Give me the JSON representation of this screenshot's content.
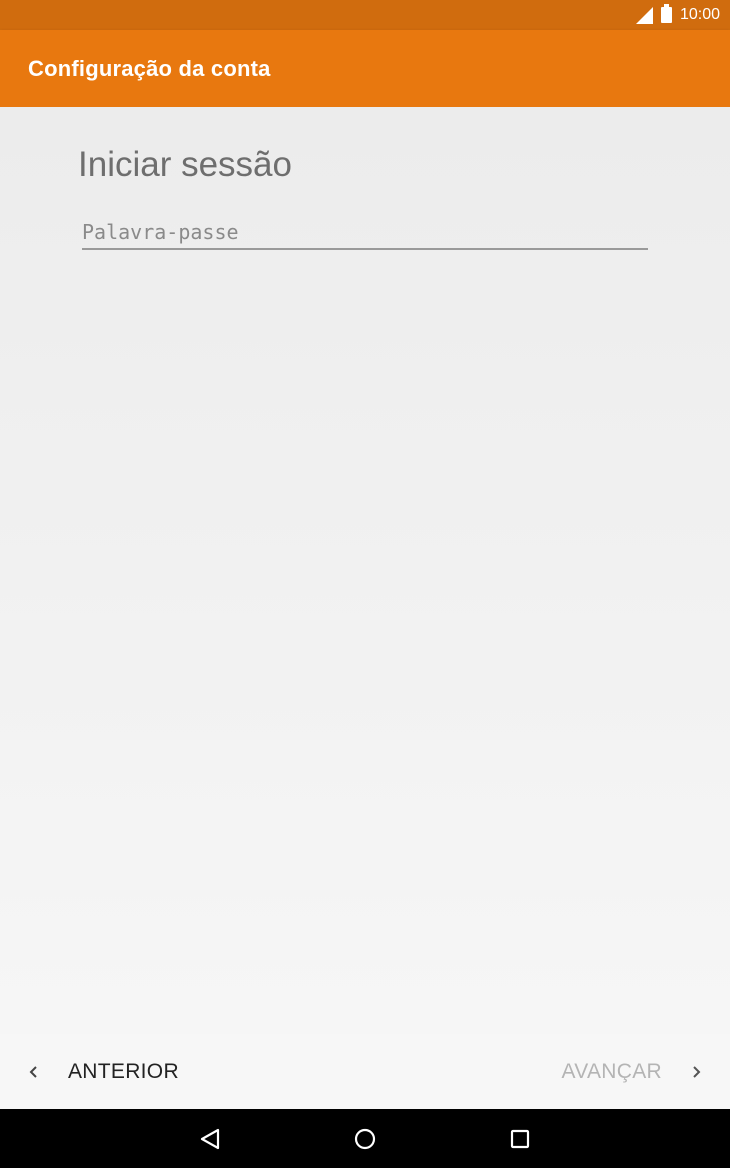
{
  "status_bar": {
    "time": "10:00",
    "icons": [
      "signal-icon",
      "battery-icon"
    ]
  },
  "app_bar": {
    "title": "Configuração da conta"
  },
  "content": {
    "heading": "Iniciar sessão",
    "password_placeholder": "Palavra-passe",
    "password_value": ""
  },
  "bottom_nav": {
    "back_label": "ANTERIOR",
    "next_label": "AVANÇAR",
    "next_enabled": false
  },
  "system_nav": {
    "icons": [
      "back-triangle-icon",
      "home-circle-icon",
      "recents-square-icon"
    ]
  },
  "colors": {
    "status_bar": "#d06c0e",
    "app_bar": "#e8780f",
    "background": "#efefef",
    "disabled_text": "#b4b4b4"
  }
}
